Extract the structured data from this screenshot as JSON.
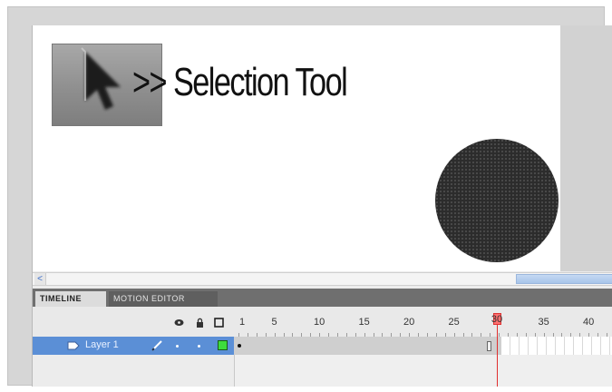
{
  "stage": {
    "tool_name": ">> Selection Tool",
    "tool_icon": "selection-arrow-icon",
    "shape": "circle"
  },
  "scrollbar": {
    "left_arrow": "<"
  },
  "tabs": [
    {
      "label": "TIMELINE",
      "active": true
    },
    {
      "label": "MOTION EDITOR",
      "active": false
    }
  ],
  "timeline": {
    "header_icons": [
      "eye-icon",
      "lock-icon",
      "outline-icon"
    ],
    "ruler_labels": [
      "1",
      "5",
      "10",
      "15",
      "20",
      "25",
      "30",
      "35",
      "40"
    ],
    "current_frame": "30",
    "layers": [
      {
        "name": "Layer 1"
      }
    ]
  },
  "colors": {
    "layer_selected": "#5b8fd6",
    "playhead": "#e03030",
    "outline_swatch": "#3ddc3d"
  }
}
